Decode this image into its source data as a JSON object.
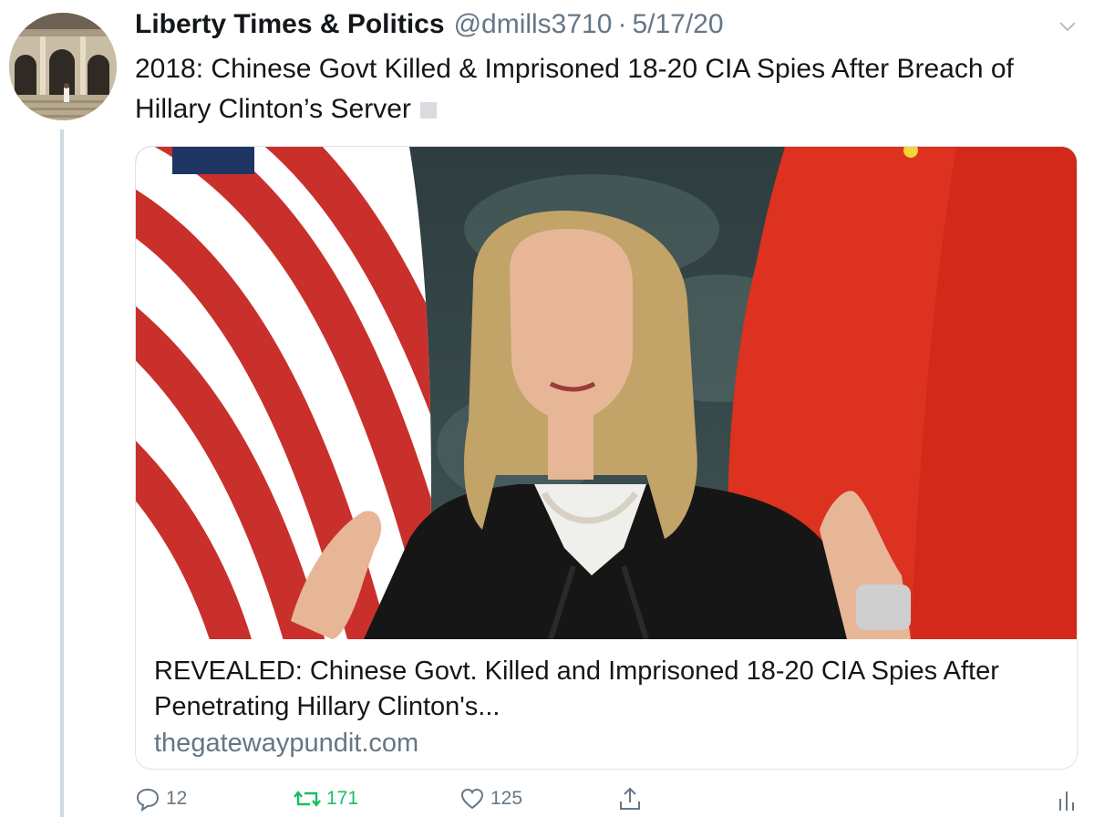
{
  "author": {
    "name": "Liberty Times & Politics",
    "handle": "@dmills3710",
    "separator": "·",
    "date": "5/17/20"
  },
  "tweet": {
    "text": "2018: Chinese Govt Killed & Imprisoned 18-20 CIA Spies After Breach of Hillary Clinton’s Server"
  },
  "card": {
    "title": "REVEALED: Chinese Govt. Killed and Imprisoned 18-20 CIA Spies After Penetrating Hillary Clinton's...",
    "domain": "thegatewaypundit.com"
  },
  "actions": {
    "replies": "12",
    "retweets": "171",
    "likes": "125"
  },
  "colors": {
    "text": "#14171a",
    "muted": "#657786",
    "retweet_active": "#17bf63",
    "border": "#dfe3e6"
  },
  "icons": [
    "chevron-down-icon",
    "reply-icon",
    "retweet-icon",
    "like-icon",
    "share-icon",
    "analytics-icon"
  ]
}
